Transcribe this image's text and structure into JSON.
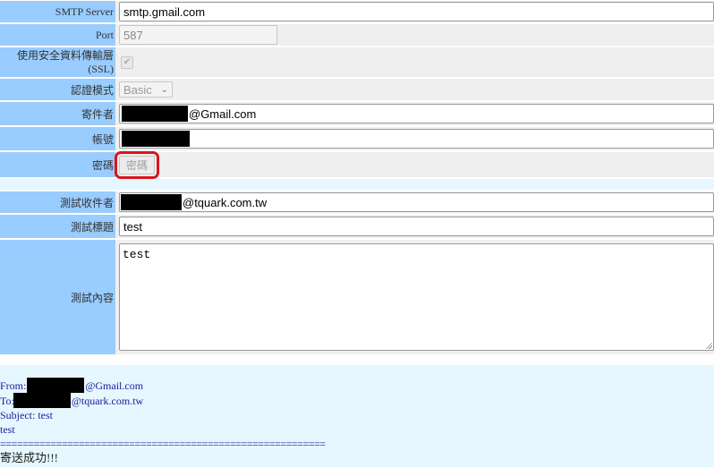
{
  "form": {
    "smtp_server_label": "SMTP Server",
    "smtp_server_value": "smtp.gmail.com",
    "port_label": "Port",
    "port_value": "587",
    "ssl_label": "使用安全資料傳輸層 (SSL)",
    "ssl_checked": true,
    "auth_label": "認證模式",
    "auth_value": "Basic",
    "sender_label": "寄件者",
    "sender_suffix": "@Gmail.com",
    "account_label": "帳號",
    "password_label": "密碼",
    "password_button": "密碼",
    "test_recipient_label": "測試收件者",
    "test_recipient_suffix": "@tquark.com.tw",
    "test_subject_label": "測試標題",
    "test_subject_value": "test",
    "test_body_label": "測試內容",
    "test_body_value": "test"
  },
  "result": {
    "from_prefix": "From:",
    "from_suffix": "@Gmail.com",
    "to_prefix": "To:",
    "to_suffix": "@tquark.com.tw",
    "subject": "Subject: test",
    "body": "test",
    "separator": "==========================================================",
    "status": "寄送成功!!!"
  },
  "colors": {
    "label_bg": "#99ccff",
    "row_bg": "#efefef",
    "result_bg": "#e6f7ff",
    "highlight": "#d9161a"
  }
}
